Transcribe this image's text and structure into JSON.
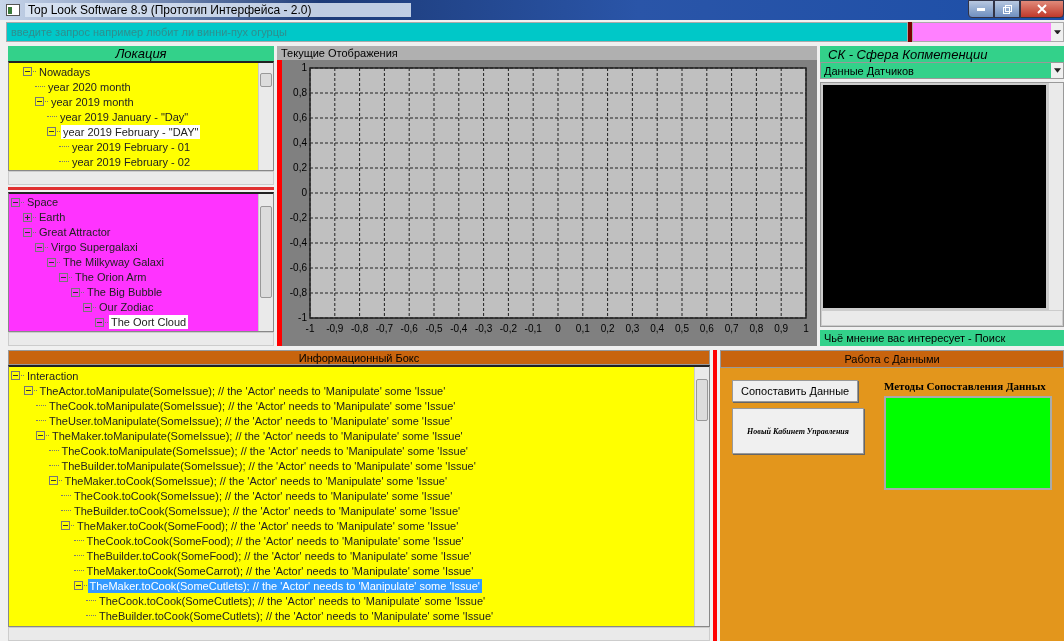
{
  "window": {
    "title": "Top Look Software 8.9 (Прототип Интерфейса - 2.0)"
  },
  "search": {
    "placeholder": "введите запрос например любит ли винни-пух огурцы"
  },
  "location_panel": {
    "title": "Локация",
    "time_tree": [
      {
        "label": "Nowadays",
        "expanded": true,
        "selected": false,
        "children": [
          {
            "label": "year 2020 month",
            "selected": false
          },
          {
            "label": "year 2019 month",
            "expanded": true,
            "selected": false,
            "children": [
              {
                "label": "year 2019 January - \"Day\"",
                "selected": false
              },
              {
                "label": "year 2019 February - \"DAY\"",
                "expanded": true,
                "selected": true,
                "children": [
                  {
                    "label": "year 2019 February - 01",
                    "selected": false
                  },
                  {
                    "label": "year 2019 February - 02",
                    "selected": false
                  }
                ]
              }
            ]
          }
        ]
      }
    ],
    "space_tree": [
      {
        "label": "Space",
        "expanded": true,
        "selected": false,
        "children": [
          {
            "label": "Earth",
            "expanded": false,
            "selected": false
          },
          {
            "label": "Great Attractor",
            "expanded": true,
            "selected": false,
            "children": [
              {
                "label": "Virgo Supergalaxi",
                "expanded": true,
                "selected": false,
                "children": [
                  {
                    "label": "The Milkyway Galaxi",
                    "expanded": true,
                    "selected": false,
                    "children": [
                      {
                        "label": "The Orion Arm",
                        "expanded": true,
                        "selected": false,
                        "children": [
                          {
                            "label": "The Big Bubble",
                            "expanded": true,
                            "selected": false,
                            "children": [
                              {
                                "label": "Our Zodiac",
                                "expanded": true,
                                "selected": false,
                                "children": [
                                  {
                                    "label": "The Oort Cloud",
                                    "expanded": true,
                                    "selected": true
                                  }
                                ]
                              }
                            ]
                          }
                        ]
                      }
                    ]
                  }
                ]
              }
            ]
          }
        ]
      }
    ]
  },
  "display_panel": {
    "title": "Текущие Отображения",
    "chart_data": {
      "type": "line",
      "grid": true,
      "xlim": [
        -1,
        1
      ],
      "ylim": [
        -1,
        1
      ],
      "xticks": [
        -1,
        {
          "value": -0.9,
          "label": "-0,9"
        },
        {
          "value": -0.8,
          "label": "-0,8"
        },
        {
          "value": -0.7,
          "label": "-0,7"
        },
        {
          "value": -0.6,
          "label": "-0,6"
        },
        {
          "value": -0.5,
          "label": "-0,5"
        },
        {
          "value": -0.4,
          "label": "-0,4"
        },
        {
          "value": -0.3,
          "label": "-0,3"
        },
        {
          "value": -0.2,
          "label": "-0,2"
        },
        {
          "value": -0.1,
          "label": "-0,1"
        },
        0,
        {
          "value": 0.1,
          "label": "0,1"
        },
        {
          "value": 0.2,
          "label": "0,2"
        },
        {
          "value": 0.3,
          "label": "0,3"
        },
        {
          "value": 0.4,
          "label": "0,4"
        },
        {
          "value": 0.5,
          "label": "0,5"
        },
        {
          "value": 0.6,
          "label": "0,6"
        },
        {
          "value": 0.7,
          "label": "0,7"
        },
        {
          "value": 0.8,
          "label": "0,8"
        },
        {
          "value": 0.9,
          "label": "0,9"
        },
        1
      ],
      "yticks": [
        1,
        {
          "value": 0.8,
          "label": "0,8"
        },
        {
          "value": 0.6,
          "label": "0,6"
        },
        {
          "value": 0.4,
          "label": "0,4"
        },
        {
          "value": 0.2,
          "label": "0,2"
        },
        0,
        {
          "value": -0.2,
          "label": "-0,2"
        },
        {
          "value": -0.4,
          "label": "-0,4"
        },
        {
          "value": -0.6,
          "label": "-0,6"
        },
        {
          "value": -0.8,
          "label": "-0,8"
        },
        -1
      ]
    }
  },
  "competence_panel": {
    "title": "СК - Сфера Копметенции",
    "dropdown": {
      "value": "Данные Датчиков"
    },
    "footer": "Чьё мнение вас интересует - Поиск"
  },
  "info_box": {
    "title": "Информационный Бокс",
    "tree": [
      {
        "label": "Interaction",
        "expanded": true,
        "selected": false,
        "children": [
          {
            "label": "TheActor.toManipulate(SomeIssue); // the 'Actor' needs to 'Manipulate' some 'Issue'",
            "expanded": true,
            "selected": false,
            "children": [
              {
                "label": "TheCook.toManipulate(SomeIssue); // the 'Actor' needs to 'Manipulate' some 'Issue'",
                "selected": false
              },
              {
                "label": "TheUser.toManipulate(SomeIssue); // the 'Actor' needs to 'Manipulate' some 'Issue'",
                "selected": false
              },
              {
                "label": "TheMaker.toManipulate(SomeIssue); // the 'Actor' needs to 'Manipulate' some 'Issue'",
                "expanded": true,
                "selected": false,
                "children": [
                  {
                    "label": "TheCook.toManipulate(SomeIssue); // the 'Actor' needs to 'Manipulate' some 'Issue'",
                    "selected": false
                  },
                  {
                    "label": "TheBuilder.toManipulate(SomeIssue); // the 'Actor' needs to 'Manipulate' some 'Issue'",
                    "selected": false
                  },
                  {
                    "label": "TheMaker.toCook(SomeIssue); // the 'Actor' needs to 'Manipulate' some 'Issue'",
                    "expanded": true,
                    "selected": false,
                    "children": [
                      {
                        "label": "TheCook.toCook(SomeIssue); // the 'Actor' needs to 'Manipulate' some 'Issue'",
                        "selected": false
                      },
                      {
                        "label": "TheBuilder.toCook(SomeIssue); // the 'Actor' needs to 'Manipulate' some 'Issue'",
                        "selected": false
                      },
                      {
                        "label": "TheMaker.toCook(SomeFood); // the 'Actor' needs to 'Manipulate' some 'Issue'",
                        "expanded": true,
                        "selected": false,
                        "children": [
                          {
                            "label": "TheCook.toCook(SomeFood); // the 'Actor' needs to 'Manipulate' some 'Issue'",
                            "selected": false
                          },
                          {
                            "label": "TheBuilder.toCook(SomeFood); // the 'Actor' needs to 'Manipulate' some 'Issue'",
                            "selected": false
                          },
                          {
                            "label": "TheMaker.toCook(SomeCarrot); // the 'Actor' needs to 'Manipulate' some 'Issue'",
                            "selected": false
                          },
                          {
                            "label": "TheMaker.toCook(SomeCutlets); // the 'Actor' needs to 'Manipulate' some 'Issue'",
                            "expanded": true,
                            "selected": true,
                            "children": [
                              {
                                "label": "TheCook.toCook(SomeCutlets); // the 'Actor' needs to 'Manipulate' some 'Issue'",
                                "selected": false
                              },
                              {
                                "label": "TheBuilder.toCook(SomeCutlets); // the 'Actor' needs to 'Manipulate' some 'Issue'",
                                "selected": false
                              }
                            ]
                          }
                        ]
                      }
                    ]
                  }
                ]
              }
            ]
          }
        ]
      }
    ]
  },
  "data_panel": {
    "title": "Работа с Данными",
    "buttons": [
      {
        "label": "Сопоставить Данные",
        "kind": "plain"
      },
      {
        "label": "Новый Кабинет Управления",
        "kind": "fancy"
      }
    ],
    "methods_label": "Методы Сопоставления Данных"
  }
}
